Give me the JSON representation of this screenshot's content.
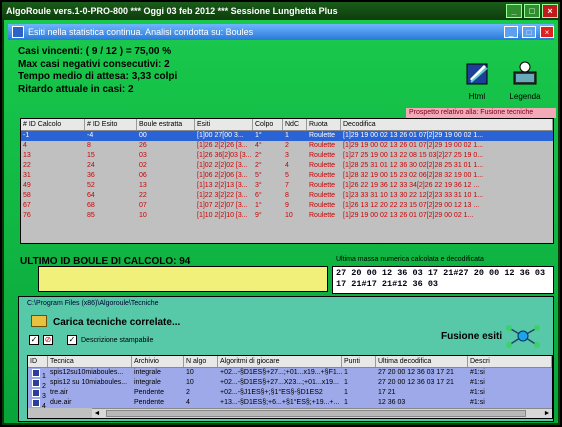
{
  "window": {
    "title": "AlgoRoule vers.1-0-PRO-800  ***  Oggi 03 feb 2012  ***  Sessione Lunghetta Plus"
  },
  "subwindow": {
    "title": "Esiti nella statistica continua. Analisi condotta su: Boules"
  },
  "stats": {
    "line1": "Casi vincenti: ( 9 / 12 ) = 75,00 %",
    "line2": "Max casi negativi consecutivi: 2",
    "line3": "Tempo medio di attesa: 3,33 colpi",
    "line4": "Ritardo attuale in casi: 2"
  },
  "tools": {
    "html_label": "Html",
    "legenda_label": "Legenda"
  },
  "prospetto_label": "Prospetto relativo alla: Fusione tecniche",
  "table1": {
    "headers": [
      "# ID Calcolo",
      "# ID Esito",
      "Boule estratta",
      "Esiti",
      "Colpo",
      "NdC",
      "Ruota",
      "Decodifica"
    ],
    "rows": [
      [
        "-1",
        "-4",
        "00",
        "[1]00 27[00 3...",
        "1°",
        "1",
        "Roulette",
        "[1]29 19 00 02 13 26 01 07[2]29 19 00 02 1..."
      ],
      [
        "4",
        "8",
        "26",
        "[1]26 2[2]26 [3...",
        "4°",
        "2",
        "Roulette",
        "[1]29 19 00 02 13 26 01 07[2]29 19 00 02 1..."
      ],
      [
        "13",
        "15",
        "03",
        "[1]26 36[2]03 [3...",
        "2°",
        "3",
        "Roulette",
        "[1]27 25 19 00 13 22 08 15 03[2]27 25 19 0..."
      ],
      [
        "22",
        "24",
        "02",
        "[1]02 2[2]02 [3...",
        "2°",
        "4",
        "Roulette",
        "[1]28 25 31 01 12 36 30 02[2]28 25 31 01 1..."
      ],
      [
        "31",
        "36",
        "06",
        "[1]06 2[2]06 [3...",
        "5°",
        "5",
        "Roulette",
        "[1]28 32 19 00 15 23 02 06[2]28 32 19 00 1..."
      ],
      [
        "49",
        "52",
        "13",
        "[1]13 2[2]13 [3...",
        "3°",
        "7",
        "Roulette",
        "[1]26 22 19 36 12 33 34[2]26 22 19 36 12 ..."
      ],
      [
        "58",
        "64",
        "22",
        "[1]22 3[2]22 [3...",
        "6°",
        "8",
        "Roulette",
        "[1]23 33 31 10 13 30 22 12[2]23 33 31 10 1..."
      ],
      [
        "67",
        "68",
        "07",
        "[1]07 2[2]07 [3...",
        "1°",
        "9",
        "Roulette",
        "[1]26 13 12 20 22 23 15 07[2]29 00 12 13 ..."
      ],
      [
        "76",
        "85",
        "10",
        "[1]10 2[2]10 [3...",
        "9°",
        "10",
        "Roulette",
        "[1]29 19 00 02 13 26 01 07[2]29 00 02 1..."
      ]
    ]
  },
  "ultimo_label": "ULTIMO  ID BOULE DI CALCOLO: 94",
  "massa_label": "Ultima massa numerica calcolata e decodificata",
  "massa_value": "27 20 00 12 36 03 17 21#27 20 00 12 36 03 17 21#17 21#12 36 03",
  "lower": {
    "path": "C:\\Program Files (x86)\\Algoroule\\Tecniche",
    "carica_label": "Carica tecniche correlate...",
    "descrizione_label": "Descrizione stampabile",
    "fusione_label": "Fusione esiti"
  },
  "table2": {
    "headers": [
      "ID",
      "Tecnica",
      "Archivio",
      "N algo",
      "Algoritmi di giocare",
      "Punti",
      "Ultima decodifica",
      "Descri"
    ],
    "rows": [
      [
        "1",
        "spis12su10miaboules...",
        "integrale",
        "10",
        "+02...-§D1ES§+27...;+01...x19...+§F1...",
        "1",
        "27 20 00 12 36 03 17 21",
        "#1:si"
      ],
      [
        "2",
        "spis12 su 10miaboules...",
        "integrale",
        "10",
        "+02...-§D1ES§+27...X23...;+01...x19...",
        "1",
        "27 20 00 12 36 03 17 21",
        "#1:si"
      ],
      [
        "3",
        "tre.air",
        "Pendente",
        "2",
        "+02...-§J1ES§+;§1°ES§-§D1ES2",
        "1",
        "17 21",
        "#1:si"
      ],
      [
        "4",
        "due.air",
        "Pendente",
        "4",
        "+13...-§D1ES§;+6...+§1°ES§;+19...+...",
        "1",
        "12 36 03",
        "#1:si"
      ]
    ]
  },
  "colors": {
    "selected_row": "#2a63d6",
    "data_text": "#cc0000",
    "panel_green": "#19c94c",
    "highlight_yellow": "#f0f07a",
    "table2_row": "#9da9e8"
  },
  "icons": {
    "html_tool": "book-icon",
    "legenda_tool": "person-computer-icon",
    "fusione": "molecule-icon",
    "carica": "folder-icon"
  }
}
